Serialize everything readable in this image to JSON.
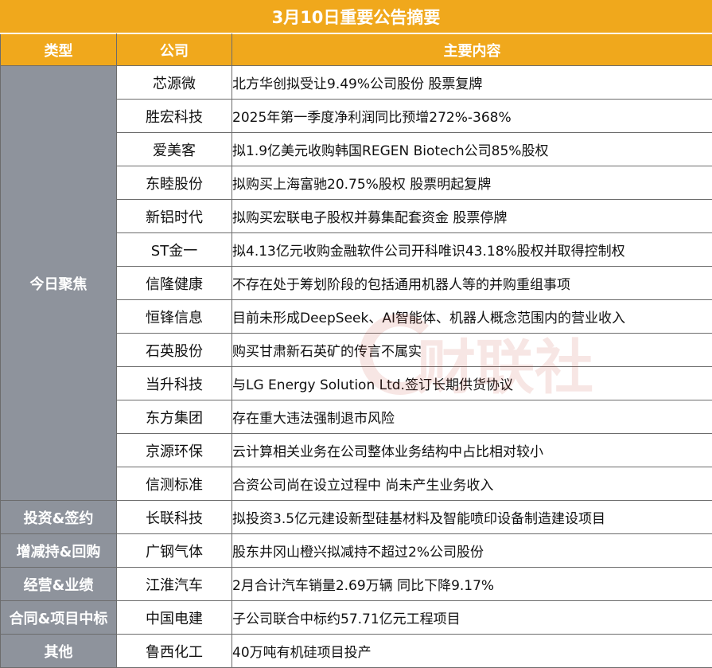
{
  "title": "3月10日重要公告摘要",
  "header": {
    "type": "类型",
    "company": "公司",
    "content": "主要内容"
  },
  "watermark": {
    "text": "财联社"
  },
  "colors": {
    "accent": "#f0a81c",
    "category_bg": "#8e939c"
  },
  "rows": [
    {
      "category": "今日聚焦",
      "company": "芯源微",
      "content": "北方华创拟受让9.49%公司股份 股票复牌"
    },
    {
      "company": "胜宏科技",
      "content": "2025年第一季度净利润同比预增272%-368%"
    },
    {
      "company": "爱美客",
      "content": "拟1.9亿美元收购韩国REGEN Biotech公司85%股权"
    },
    {
      "company": "东睦股份",
      "content": "拟购买上海富驰20.75%股权 股票明起复牌"
    },
    {
      "company": "新铝时代",
      "content": "拟购买宏联电子股权并募集配套资金 股票停牌"
    },
    {
      "company": "ST金一",
      "content": "拟4.13亿元收购金融软件公司开科唯识43.18%股权并取得控制权"
    },
    {
      "company": "信隆健康",
      "content": "不存在处于筹划阶段的包括通用机器人等的并购重组事项"
    },
    {
      "company": "恒锋信息",
      "content": "目前未形成DeepSeek、AI智能体、机器人概念范围内的营业收入"
    },
    {
      "company": "石英股份",
      "content": "购买甘肃新石英矿的传言不属实"
    },
    {
      "company": "当升科技",
      "content": "与LG Energy Solution Ltd.签订长期供货协议"
    },
    {
      "company": "东方集团",
      "content": "存在重大违法强制退市风险"
    },
    {
      "company": "京源环保",
      "content": "云计算相关业务在公司整体业务结构中占比相对较小"
    },
    {
      "company": "信测标准",
      "content": "合资公司尚在设立过程中 尚未产生业务收入"
    },
    {
      "category": "投资&签约",
      "company": "长联科技",
      "content": "拟投资3.5亿元建设新型硅基材料及智能喷印设备制造建设项目"
    },
    {
      "category": "增减持&回购",
      "company": "广钢气体",
      "content": "股东井冈山橙兴拟减持不超过2%公司股份"
    },
    {
      "category": "经营&业绩",
      "company": "江淮汽车",
      "content": "2月合计汽车销量2.69万辆 同比下降9.17%"
    },
    {
      "category": "合同&项目中标",
      "company": "中国电建",
      "content": "子公司联合中标约57.71亿元工程项目"
    },
    {
      "category": "其他",
      "company": "鲁西化工",
      "content": "40万吨有机硅项目投产"
    }
  ]
}
